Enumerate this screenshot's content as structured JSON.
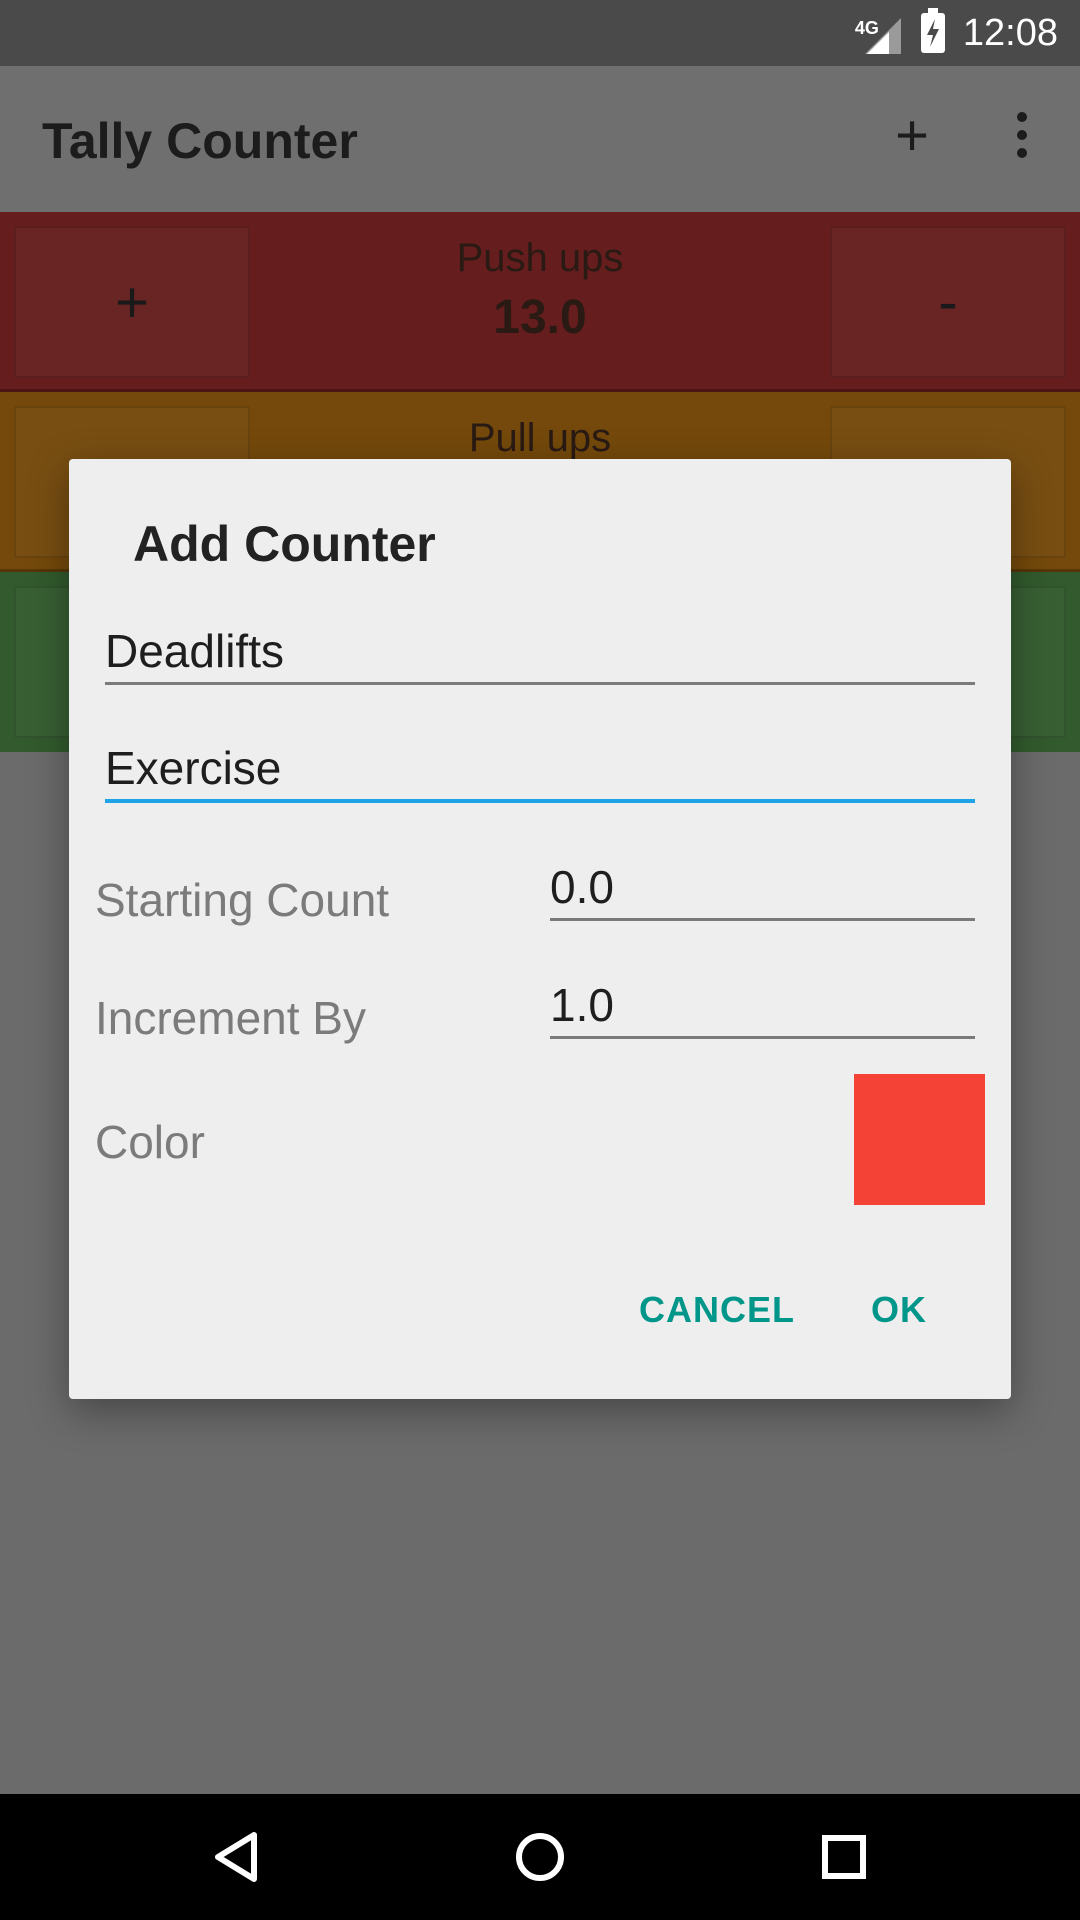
{
  "status_bar": {
    "network": "4G",
    "time": "12:08",
    "icons": [
      "signal-icon",
      "battery-charging-icon"
    ]
  },
  "app_bar": {
    "title": "Tally Counter",
    "add_icon": "+",
    "menu_icon": "more-vert-icon"
  },
  "counters": [
    {
      "name": "Push ups",
      "value": "13.0",
      "plus": "+",
      "minus": "-",
      "color": "#7a1f1f"
    },
    {
      "name": "Pull ups",
      "value": "",
      "plus": "",
      "minus": "",
      "color": "#8a5a0a"
    },
    {
      "name": "",
      "value": "",
      "plus": "",
      "minus": "",
      "color": "#3d6b35"
    }
  ],
  "dialog": {
    "title": "Add Counter",
    "name_value": "Deadlifts",
    "category_value": "Exercise",
    "starting_count_label": "Starting Count",
    "starting_count_value": "0.0",
    "increment_label": "Increment By",
    "increment_value": "1.0",
    "color_label": "Color",
    "color_value": "#f44336",
    "cancel_label": "CANCEL",
    "ok_label": "OK",
    "accent_color": "#00968a",
    "focus_color": "#1ea3e8"
  },
  "nav_bar": {
    "icons": [
      "back-icon",
      "home-icon",
      "recents-icon"
    ]
  }
}
